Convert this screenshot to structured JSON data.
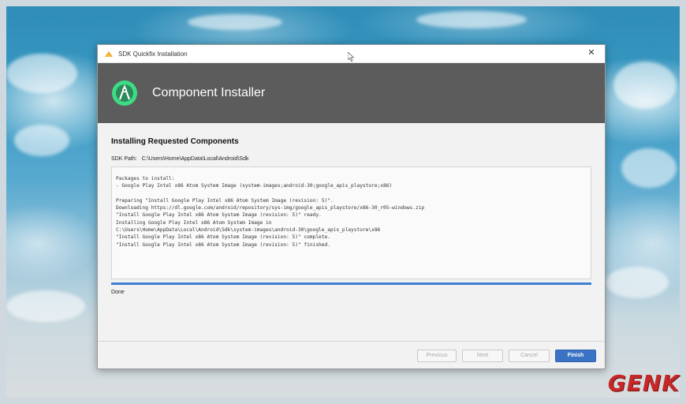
{
  "window": {
    "title": "SDK Quickfix Installation",
    "close_glyph": "✕"
  },
  "banner": {
    "title": "Component Installer",
    "icon": "android-studio-logo"
  },
  "main": {
    "section_title": "Installing Requested Components",
    "sdk_path_label": "SDK Path:",
    "sdk_path_value": "C:\\Users\\Home\\AppData\\Local\\Android\\Sdk",
    "log_lines": [
      "Packages to install:",
      "- Google Play Intel x86 Atom System Image (system-images;android-30;google_apis_playstore;x86)",
      "",
      "Preparing \"Install Google Play Intel x86 Atom System Image (revision: 5)\".",
      "Downloading https://dl.google.com/android/repository/sys-img/google_apis_playstore/x86-30_r05-windows.zip",
      "\"Install Google Play Intel x86 Atom System Image (revision: 5)\" ready.",
      "Installing Google Play Intel x86 Atom System Image in",
      "C:\\Users\\Home\\AppData\\Local\\Android\\Sdk\\system-images\\android-30\\google_apis_playstore\\x86",
      "\"Install Google Play Intel x86 Atom System Image (revision: 5)\" complete.",
      "\"Install Google Play Intel x86 Atom System Image (revision: 5)\" finished."
    ],
    "progress_percent": 100,
    "status": "Done"
  },
  "buttons": {
    "previous": "Previous",
    "next": "Next",
    "cancel": "Cancel",
    "finish": "Finish"
  },
  "watermark": "GENK",
  "colors": {
    "banner_bg": "#5c5c5c",
    "accent": "#3f7fd1",
    "finish_button": "#3b73c4",
    "watermark": "#c62828"
  }
}
